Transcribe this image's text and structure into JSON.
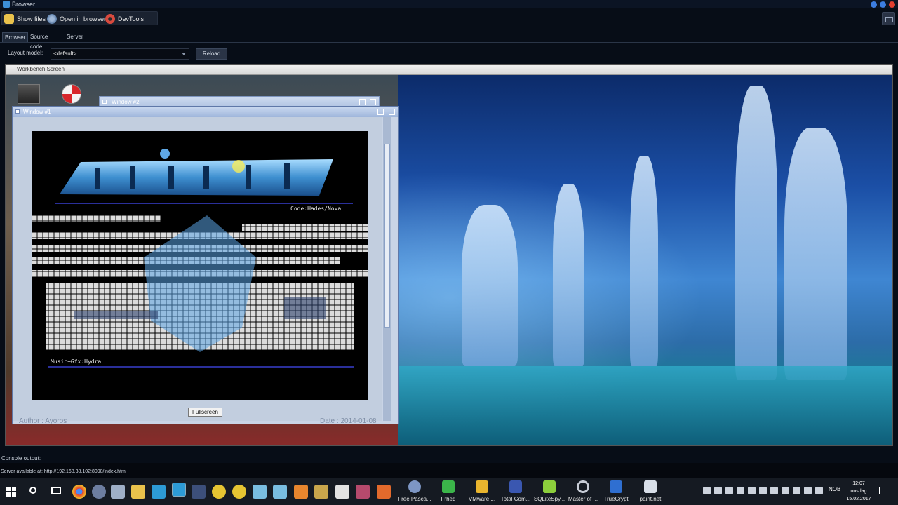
{
  "window": {
    "title": "Browser"
  },
  "toolbar": {
    "show_files": "Show files",
    "open_in_browser": "Open in browser",
    "devtools": "DevTools"
  },
  "tabs": [
    "Browser",
    "Source code",
    "Server"
  ],
  "layout": {
    "label": "Layout model:",
    "value": "<default>",
    "reload": "Reload"
  },
  "workbench": {
    "title": "Workbench Screen",
    "window2_title": "Window #2",
    "window1": {
      "title": "Window #1",
      "credit_code": "Code:Hades/Nova",
      "credit_music": "Music+Gfx:Hydra",
      "fullscreen": "Fullscreen",
      "author": "Author : Ayoros",
      "date": "Date : 2014-01-08"
    }
  },
  "console": {
    "label": "Console output:",
    "line": "Server available at: http://192.168.38.102:8090/index.html"
  },
  "taskbar": {
    "apps": [
      "Free Pasca...",
      "Frhed",
      "VMware ...",
      "Total Com...",
      "SQLiteSpy...",
      "Master of ...",
      "TrueCrypt",
      "paint.net"
    ],
    "language": "NOB",
    "time": "12:07",
    "day": "onsdag",
    "date": "15.02.2017"
  }
}
